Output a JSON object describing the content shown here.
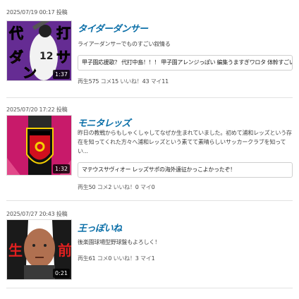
{
  "items": [
    {
      "timestamp": "2025/07/19 00:17",
      "action": "投稿",
      "title": "タイダーダンサー",
      "description": "ライアーダンサーでものすごい叙情る",
      "comment": "甲子園応援歌？ 代打中島！！！ 甲子園アレンジっぽい 編集うますぎワロタ 体幹すごいな 草",
      "duration": "1:37",
      "thumb_text": [
        "代",
        "打",
        "ダ",
        "ン",
        "サ"
      ],
      "thumb_jersey": "12",
      "stats": {
        "views_label": "再生",
        "views": "575",
        "comments_label": "コメ",
        "comments": "15",
        "likes_label": "いいね！",
        "likes": "43",
        "mylist_label": "マイ",
        "mylist": "11"
      }
    },
    {
      "timestamp": "2025/07/20 17:22",
      "action": "投稿",
      "title": "モニタレッズ",
      "description": "昨日の教戦からもしゃくしゃしてなぜか生まれていました。初めて浦和レッズという存在を知ってくれた方々へ浦和レッズという素てて素晴らしいサッカークラブを知ってい...",
      "comment": "マテウスサヴィオー レッズサポの海外遠征かっこよかったぞ！",
      "duration": "1:32",
      "stats": {
        "views_label": "再生",
        "views": "50",
        "comments_label": "コメ",
        "comments": "2",
        "likes_label": "いいね！",
        "likes": "0",
        "mylist_label": "マイ",
        "mylist": "0"
      }
    },
    {
      "timestamp": "2025/07/27 20:43",
      "action": "投稿",
      "title": "王っぽいね",
      "description": "後楽園球場型野球盤もよろしく！",
      "duration": "0:21",
      "thumb_text": [
        "生",
        "前"
      ],
      "stats": {
        "views_label": "再生",
        "views": "61",
        "comments_label": "コメ",
        "comments": "0",
        "likes_label": "いいね！",
        "likes": "3",
        "mylist_label": "マイ",
        "mylist": "1"
      }
    }
  ],
  "colors": {
    "title": "#0b6fa8",
    "item1_bg": "#5b2a86",
    "item2_bg": "#c8102e",
    "item3_bg": "#1a1a1a"
  }
}
